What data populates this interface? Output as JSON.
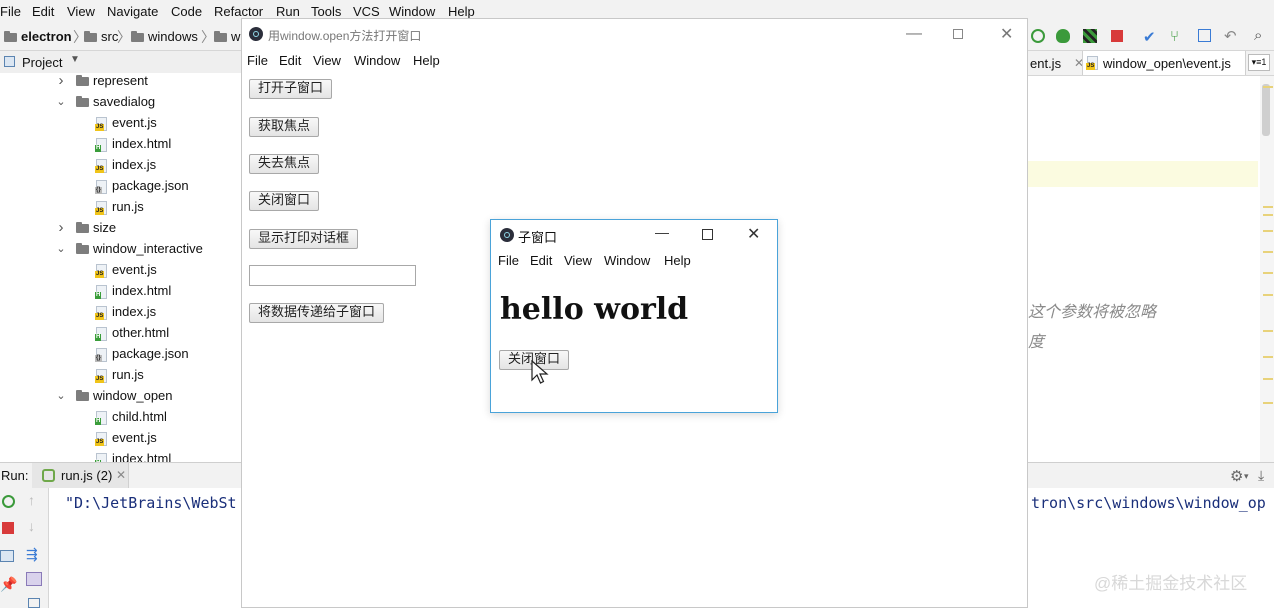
{
  "ide_menu": [
    "File",
    "Edit",
    "View",
    "Navigate",
    "Code",
    "Refactor",
    "Run",
    "Tools",
    "VCS",
    "Window",
    "Help"
  ],
  "breadcrumb": [
    "electron",
    "src",
    "windows",
    "w"
  ],
  "project_panel": {
    "title": "Project",
    "rows": [
      {
        "kind": "folder",
        "label": "represent",
        "arrow": ">"
      },
      {
        "kind": "folder",
        "label": "savedialog",
        "arrow": "v"
      },
      {
        "kind": "js",
        "label": "event.js"
      },
      {
        "kind": "html",
        "label": "index.html"
      },
      {
        "kind": "js",
        "label": "index.js"
      },
      {
        "kind": "json",
        "label": "package.json"
      },
      {
        "kind": "js",
        "label": "run.js"
      },
      {
        "kind": "folder",
        "label": "size",
        "arrow": ">"
      },
      {
        "kind": "folder",
        "label": "window_interactive",
        "arrow": "v"
      },
      {
        "kind": "js",
        "label": "event.js"
      },
      {
        "kind": "html",
        "label": "index.html"
      },
      {
        "kind": "js",
        "label": "index.js"
      },
      {
        "kind": "html",
        "label": "other.html"
      },
      {
        "kind": "json",
        "label": "package.json"
      },
      {
        "kind": "js",
        "label": "run.js"
      },
      {
        "kind": "folder",
        "label": "window_open",
        "arrow": "v"
      },
      {
        "kind": "html",
        "label": "child.html"
      },
      {
        "kind": "js",
        "label": "event.js"
      },
      {
        "kind": "html",
        "label": "index.html"
      }
    ]
  },
  "editor": {
    "tab_partial": "ent.js",
    "tab_active": "window_open\\event.js",
    "tab_more": "▾≡1",
    "comment_line_1": "这个参数将被忽略",
    "comment_line_2": "度"
  },
  "run_panel": {
    "label": "Run:",
    "tab": "run.js (2)",
    "console_left": "\"D:\\JetBrains\\WebSt",
    "console_right": "tron\\src\\windows\\window_op"
  },
  "main_window": {
    "title": "用window.open方法打开窗口",
    "menu": [
      "File",
      "Edit",
      "View",
      "Window",
      "Help"
    ],
    "buttons": [
      "打开子窗口",
      "获取焦点",
      "失去焦点",
      "关闭窗口",
      "显示打印对话框"
    ],
    "send_button": "将数据传递给子窗口",
    "input_value": ""
  },
  "child_window": {
    "title": "子窗口",
    "menu": [
      "File",
      "Edit",
      "View",
      "Window",
      "Help"
    ],
    "heading": "hello world",
    "close_button": "关闭窗口"
  },
  "watermark": "@稀土掘金技术社区"
}
